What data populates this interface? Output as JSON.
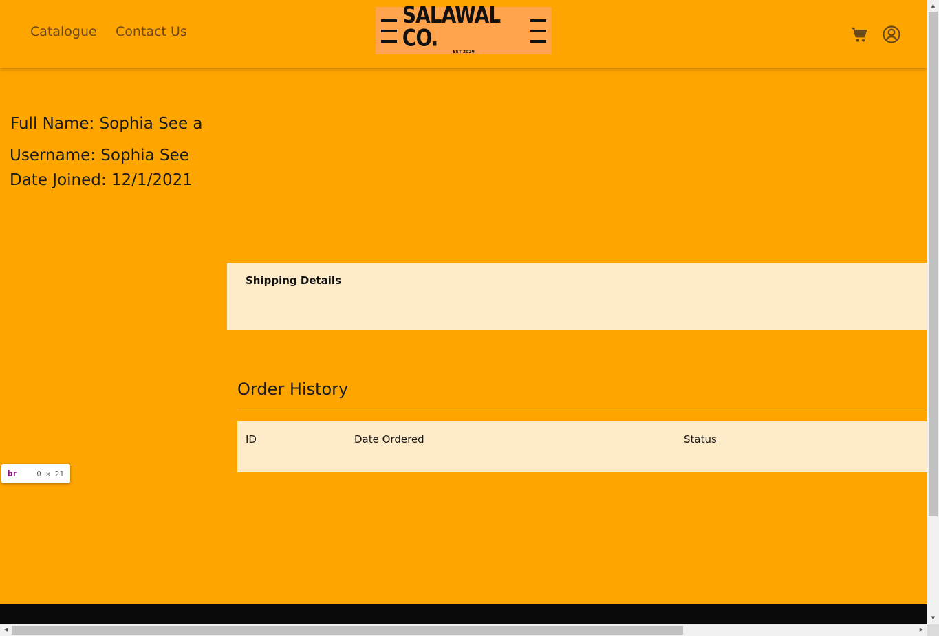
{
  "header": {
    "nav": [
      {
        "label": "Catalogue"
      },
      {
        "label": "Contact Us"
      }
    ],
    "logo": {
      "name": "SALAWAL CO.",
      "tagline": "EST 2020"
    },
    "icons": {
      "cart": "shopping-cart-icon",
      "account": "user-circle-icon"
    }
  },
  "profile": {
    "full_name": "Full Name: Sophia See a",
    "username": "Username: Sophia See",
    "date_joined": "Date Joined: 12/1/2021"
  },
  "shipping": {
    "title": "Shipping Details"
  },
  "orders": {
    "title": "Order History",
    "columns": [
      "ID",
      "Date Ordered",
      "Status"
    ]
  },
  "devtools_tooltip": {
    "tag": "br",
    "size": "0 × 21"
  },
  "colors": {
    "background": "#ffa500",
    "panel": "#feebc9",
    "logo_bg": "#ffa44d",
    "footer": "#0a0a0a",
    "nav_text": "#6b4a1a"
  }
}
